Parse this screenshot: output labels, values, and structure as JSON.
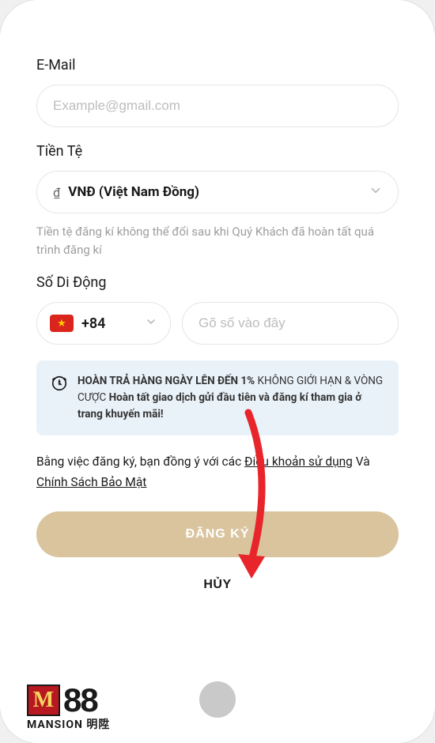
{
  "form": {
    "email": {
      "label": "E-Mail",
      "placeholder": "Example@gmail.com",
      "value": ""
    },
    "currency": {
      "label": "Tiền Tệ",
      "symbol": "₫",
      "selected": "VNĐ (Việt Nam Đồng)",
      "help_text": "Tiền tệ đăng kí không thể đổi sau khi Quý Khách đã hoàn tất quá trình đăng kí"
    },
    "mobile": {
      "label": "Số Di Động",
      "dial_code": "+84",
      "placeholder": "Gõ số vào đây",
      "value": ""
    }
  },
  "promo": {
    "bold1": "HOÀN TRẢ HÀNG NGÀY LÊN ĐẾN 1%",
    "plain1": " KHÔNG GIỚI HẠN & VÒNG CƯỢC ",
    "bold2": "Hoàn tất giao dịch gửi đầu tiên và đăng kí tham gia ở trang khuyến mãi!"
  },
  "terms": {
    "prefix": "Bằng việc đăng ký, bạn đồng ý với các ",
    "terms_link": "Điều khoản sử dụng",
    "mid": " Và ",
    "privacy_link": "Chính Sách Bảo Mật"
  },
  "buttons": {
    "register": "ĐĂNG KÝ",
    "cancel": "HỦY"
  },
  "logo": {
    "m": "M",
    "eight": "88",
    "sub": "MANSION 明陞"
  }
}
